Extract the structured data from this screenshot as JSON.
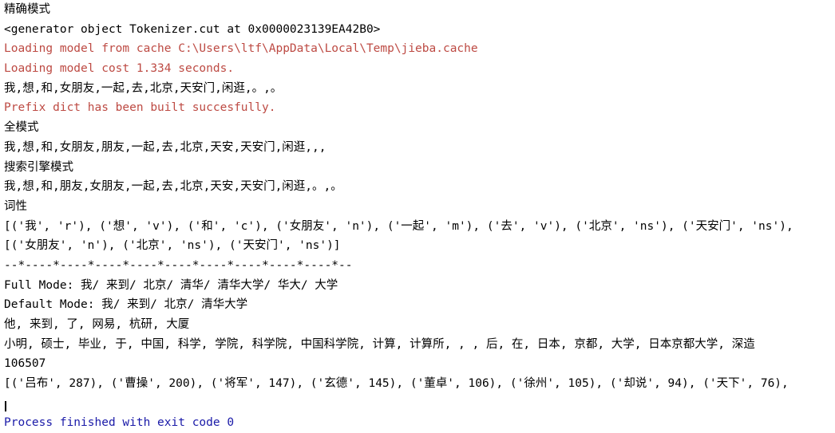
{
  "console": {
    "background_color": "#ffffff",
    "default_text_color": "#000000",
    "error_text_color": "#bd4a43",
    "info_text_color": "#1a1aa8",
    "caret_visible": true,
    "lines": [
      {
        "id": "precise-mode-header",
        "text": "精确模式",
        "style": "default"
      },
      {
        "id": "generator-object",
        "text": "<generator object Tokenizer.cut at 0x0000023139EA42B0>",
        "style": "default"
      },
      {
        "id": "loading-model-cache",
        "text": "Loading model from cache C:\\Users\\ltf\\AppData\\Local\\Temp\\jieba.cache",
        "style": "error"
      },
      {
        "id": "loading-model-cost",
        "text": "Loading model cost 1.334 seconds.",
        "style": "error"
      },
      {
        "id": "precise-mode-result",
        "text": "我,想,和,女朋友,一起,去,北京,天安门,闲逛,。,。",
        "style": "default"
      },
      {
        "id": "prefix-dict-built",
        "text": "Prefix dict has been built succesfully.",
        "style": "error"
      },
      {
        "id": "full-mode-header",
        "text": "全模式",
        "style": "default"
      },
      {
        "id": "full-mode-result",
        "text": "我,想,和,女朋友,朋友,一起,去,北京,天安,天安门,闲逛,,,",
        "style": "default"
      },
      {
        "id": "search-engine-mode-header",
        "text": "搜索引擎模式",
        "style": "default"
      },
      {
        "id": "search-engine-mode-result",
        "text": "我,想,和,朋友,女朋友,一起,去,北京,天安,天安门,闲逛,。,。",
        "style": "default"
      },
      {
        "id": "pos-tagging-header",
        "text": "词性",
        "style": "default"
      },
      {
        "id": "pos-tagging-result",
        "text": "[('我', 'r'), ('想', 'v'), ('和', 'c'), ('女朋友', 'n'), ('一起', 'm'), ('去', 'v'), ('北京', 'ns'), ('天安门', 'ns'),",
        "style": "default"
      },
      {
        "id": "noun-extraction-result",
        "text": "[('女朋友', 'n'), ('北京', 'ns'), ('天安门', 'ns')]",
        "style": "default"
      },
      {
        "id": "separator-line",
        "text": "--*----*----*----*----*----*----*----*----*----*--",
        "style": "default"
      },
      {
        "id": "full-mode-tsinghua",
        "text": "Full Mode: 我/ 来到/ 北京/ 清华/ 清华大学/ 华大/ 大学",
        "style": "default"
      },
      {
        "id": "default-mode-tsinghua",
        "text": "Default Mode: 我/ 来到/ 北京/ 清华大学",
        "style": "default"
      },
      {
        "id": "netease-result",
        "text": "他, 来到, 了, 网易, 杭研, 大厦",
        "style": "default"
      },
      {
        "id": "xiaoming-result",
        "text": "小明, 硕士, 毕业, 于, 中国, 科学, 学院, 科学院, 中国科学院, 计算, 计算所, , , 后, 在, 日本, 京都, 大学, 日本京都大学, 深造",
        "style": "default"
      },
      {
        "id": "word-count",
        "text": "106507",
        "style": "default"
      },
      {
        "id": "topk-keywords",
        "text": "[('吕布', 287), ('曹操', 200), ('将军', 147), ('玄德', 145), ('董卓', 106), ('徐州', 105), ('却说', 94), ('天下', 76),",
        "style": "default"
      },
      {
        "id": "empty-line",
        "text": " ",
        "style": "blank"
      },
      {
        "id": "process-finished",
        "text": "Process finished with exit code 0",
        "style": "info"
      }
    ]
  }
}
